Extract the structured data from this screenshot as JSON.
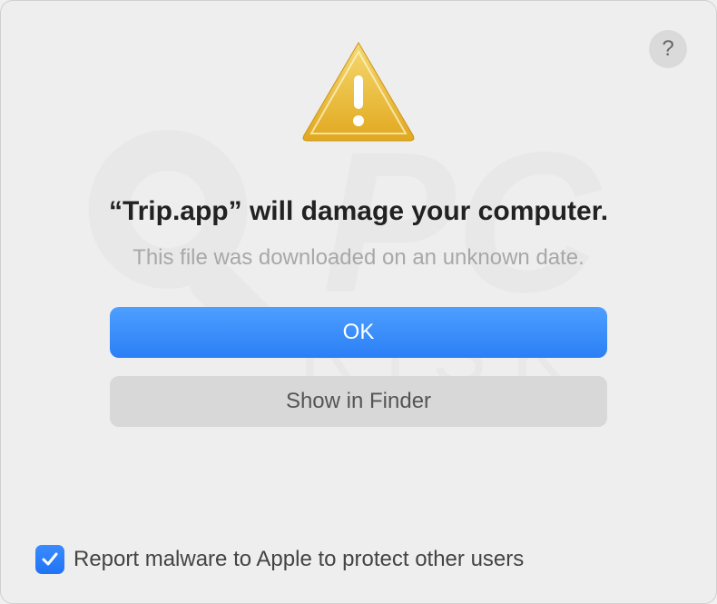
{
  "dialog": {
    "headline": "“Trip.app” will damage your computer.",
    "subtext": "This file was downloaded on an unknown date.",
    "buttons": {
      "primary": "OK",
      "secondary": "Show in Finder"
    },
    "help": "?",
    "checkbox": {
      "label": "Report malware to Apple to protect other users",
      "checked": true
    }
  },
  "icons": {
    "warning": "warning-triangle",
    "help": "question-mark",
    "check": "checkmark"
  },
  "colors": {
    "primary_button": "#2b7ff5",
    "warning_yellow": "#e5b829"
  }
}
